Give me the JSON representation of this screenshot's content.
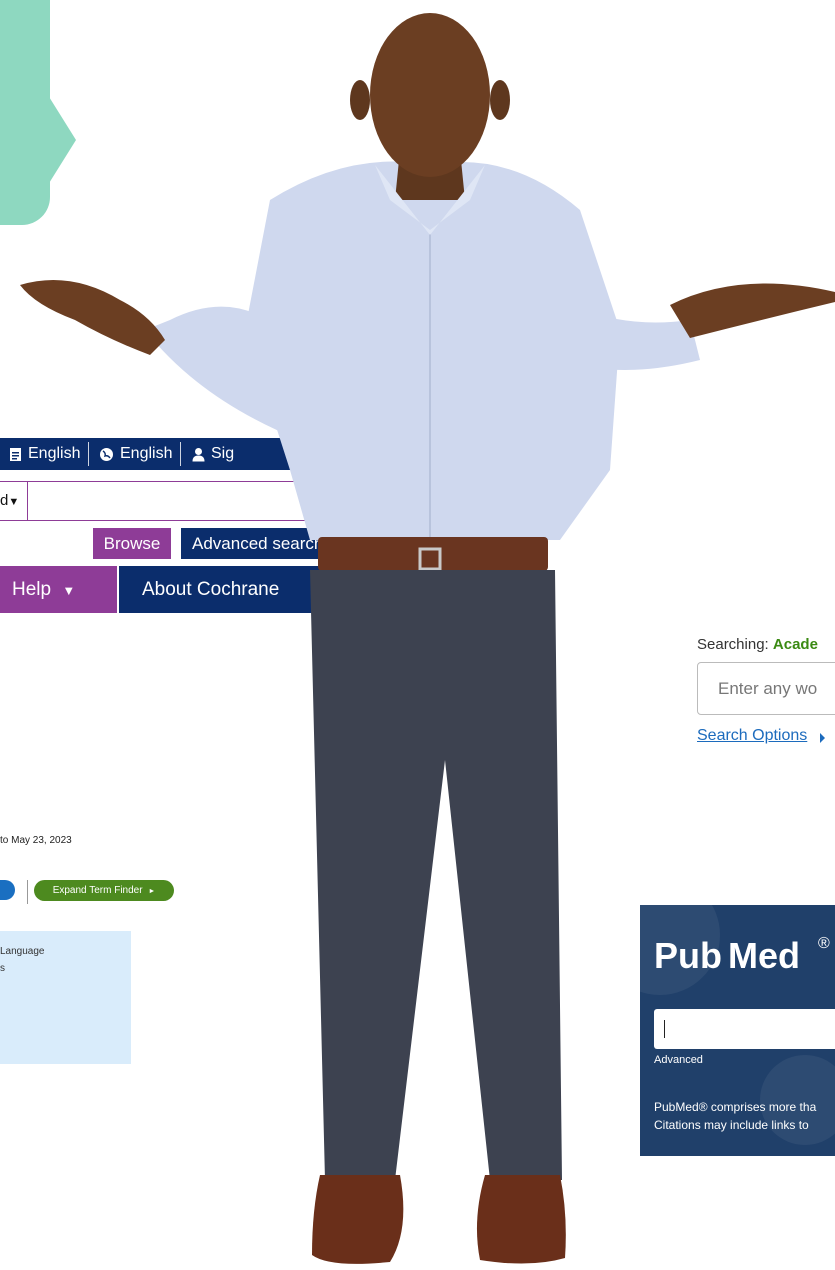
{
  "cochrane": {
    "language_links": [
      "English",
      "English"
    ],
    "signin_label": "Sig",
    "scope_label": "d",
    "browse_label": "Browse",
    "advanced_search_label": "Advanced search",
    "help_label": "Help",
    "about_label": "About Cochrane",
    "accent_purple": "#8e3c97",
    "accent_navy": "#0b2d6c"
  },
  "ovid": {
    "date_range_text": "to May 23, 2023",
    "expand_button_label": "Expand Term Finder",
    "panel_lines": [
      "Language",
      "s"
    ],
    "accent_green": "#4d8a1f"
  },
  "ebsco": {
    "searching_prefix": "Searching:",
    "searching_db": "Acade",
    "input_placeholder": "Enter any wo",
    "search_options_label": "Search Options"
  },
  "pubmed": {
    "logo_left": "Pub",
    "logo_right": "Med",
    "advanced_label": "Advanced",
    "description_lines": [
      "PubMed® comprises more tha",
      "Citations may include links to"
    ]
  }
}
